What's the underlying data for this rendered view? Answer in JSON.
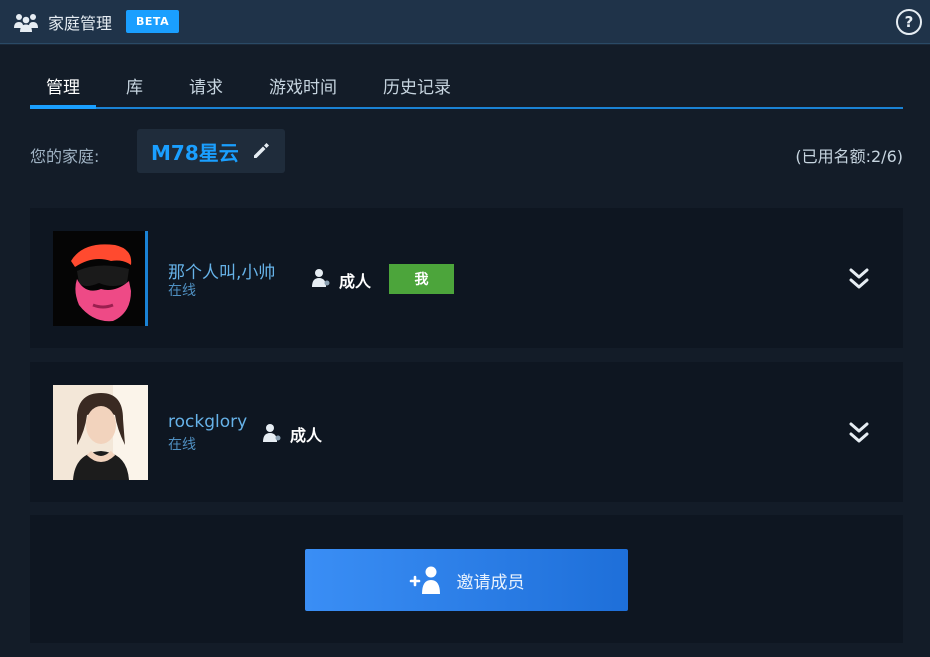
{
  "header": {
    "title": "家庭管理",
    "beta": "BETA",
    "help": "?"
  },
  "tabs": [
    {
      "label": "管理",
      "active": true
    },
    {
      "label": "库",
      "active": false
    },
    {
      "label": "请求",
      "active": false
    },
    {
      "label": "游戏时间",
      "active": false
    },
    {
      "label": "历史记录",
      "active": false
    }
  ],
  "family": {
    "label": "您的家庭:",
    "name": "M78星云",
    "quota": "(已用名额:2/6)"
  },
  "members": [
    {
      "name": "那个人叫,小帅",
      "status": "在线",
      "role": "成人",
      "badge": "我"
    },
    {
      "name": "rockglory",
      "status": "在线",
      "role": "成人"
    }
  ],
  "invite": {
    "label": "邀请成员"
  },
  "colors": {
    "accent": "#1a9fff",
    "me_badge": "#4ca53b",
    "header_bg": "#1f3349",
    "panel_bg": "#0e1621"
  },
  "icons": {
    "family": "family-icon",
    "edit": "pencil-icon",
    "role": "adult-user-icon",
    "expand": "double-chevron-down-icon",
    "invite": "add-user-icon"
  }
}
